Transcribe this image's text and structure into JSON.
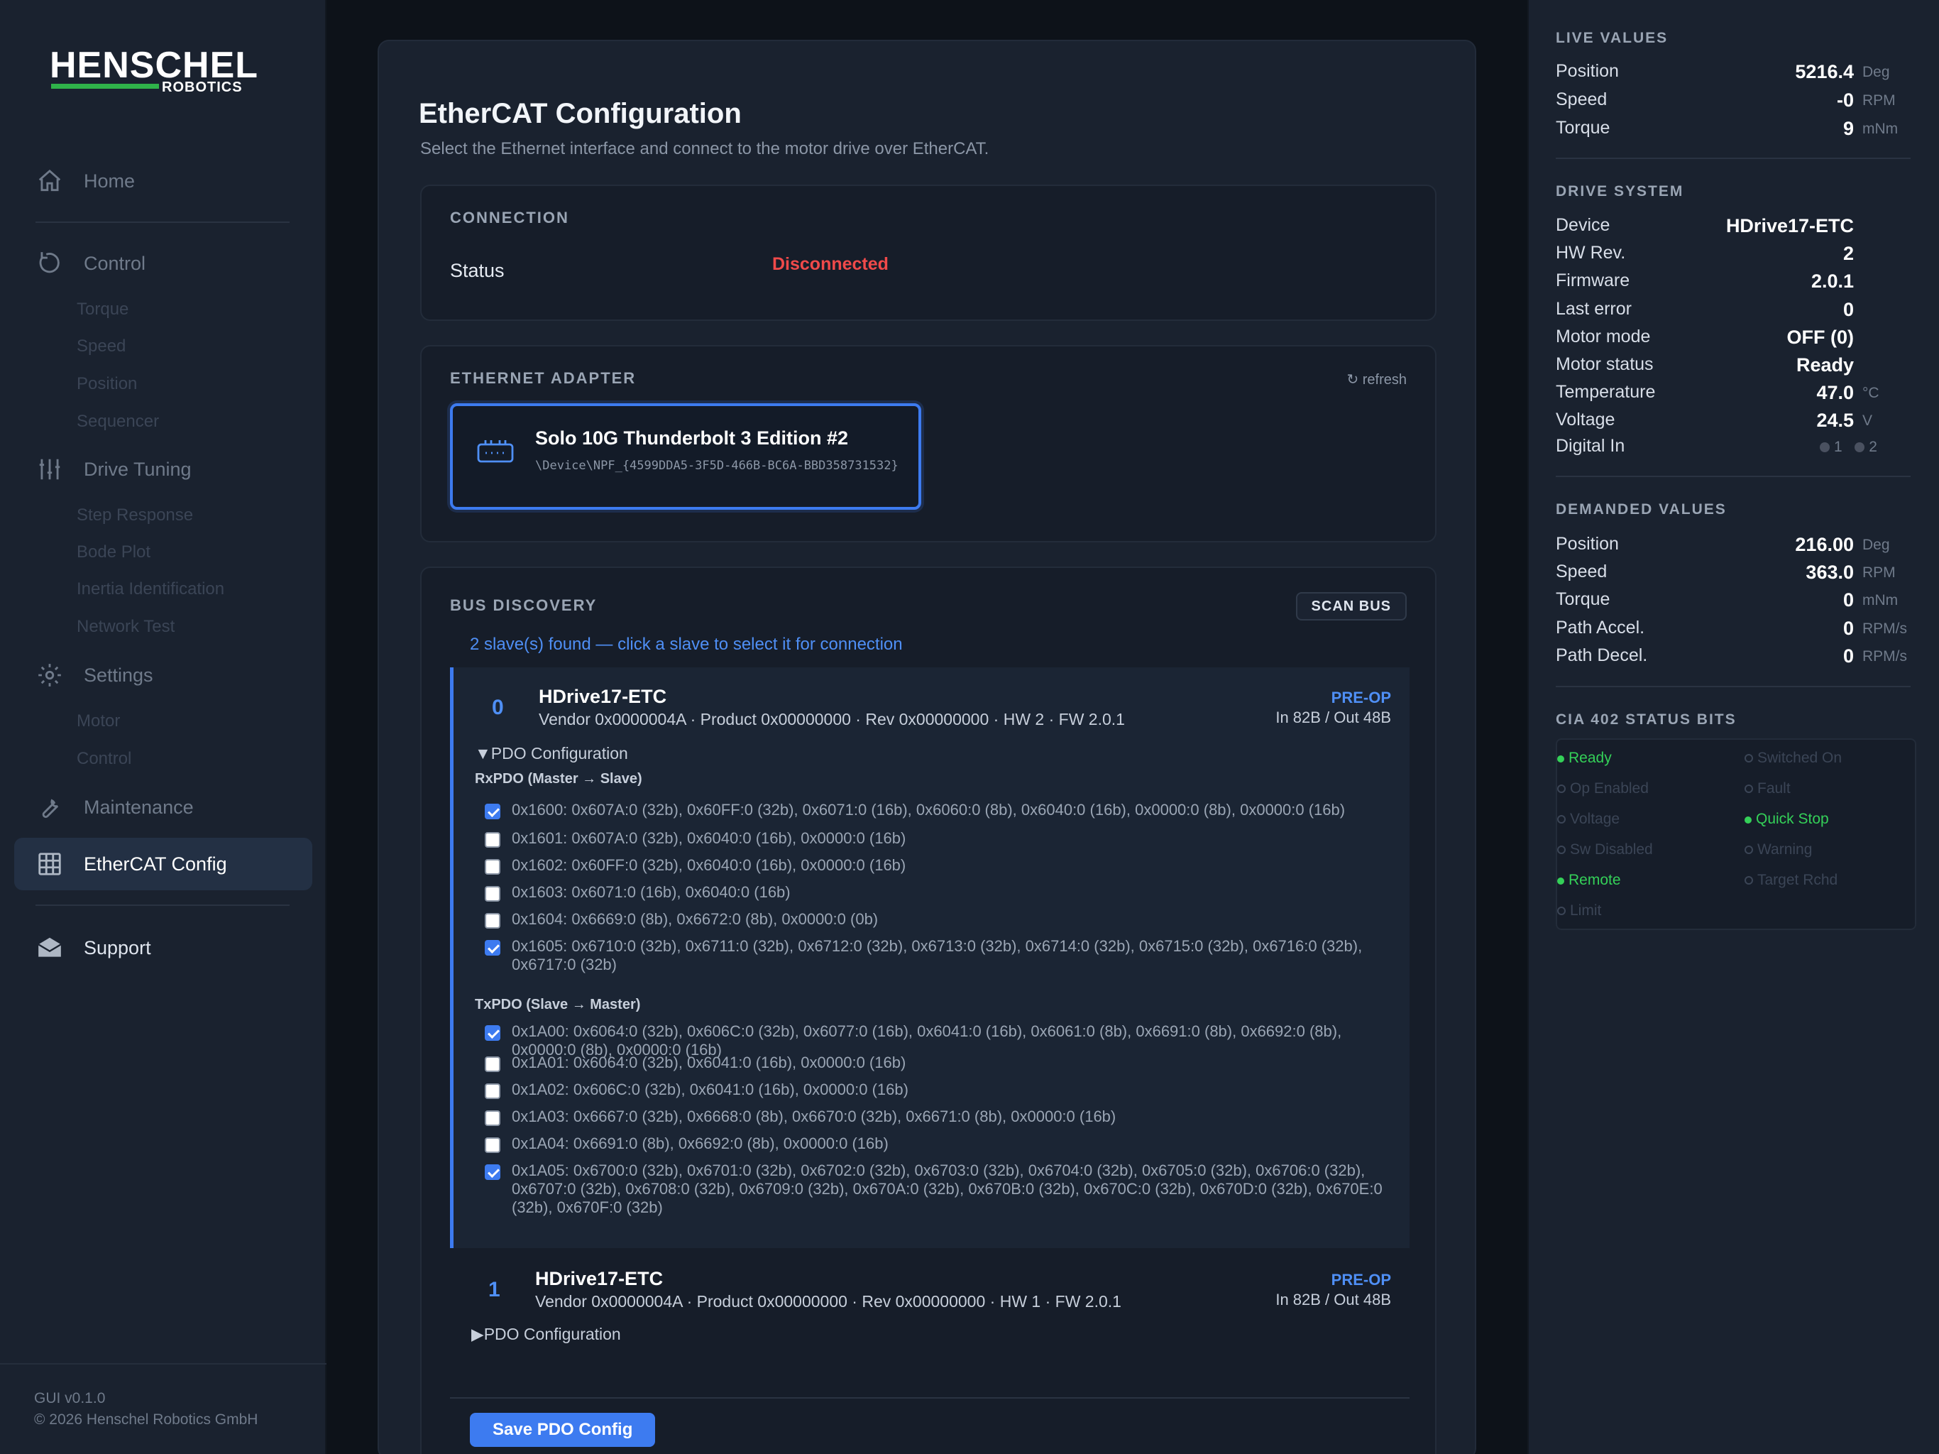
{
  "sidebar": {
    "brand": "HENSCHEL",
    "brand_sub": "ROBOTICS",
    "home": "Home",
    "control": "Control",
    "control_items": [
      "Torque",
      "Speed",
      "Position",
      "Sequencer"
    ],
    "drive_tuning": "Drive Tuning",
    "drive_tuning_items": [
      "Step Response",
      "Bode Plot",
      "Inertia Identification",
      "Network Test"
    ],
    "settings": "Settings",
    "settings_items": [
      "Motor",
      "Control"
    ],
    "maintenance": "Maintenance",
    "ethercat": "EtherCAT Config",
    "support": "Support",
    "version": "GUI v0.1.0",
    "copyright": "© 2026 Henschel Robotics GmbH"
  },
  "main": {
    "title": "EtherCAT Configuration",
    "subtitle": "Select the Ethernet interface and connect to the motor drive over EtherCAT.",
    "connection": {
      "header": "CONNECTION",
      "status_label": "Status",
      "status_value": "Disconnected"
    },
    "adapter": {
      "header": "ETHERNET ADAPTER",
      "refresh": "↻ refresh",
      "name": "Solo 10G Thunderbolt 3 Edition #2",
      "path": "\\Device\\NPF_{4599DDA5-3F5D-466B-BC6A-BBD358731532}"
    },
    "bus": {
      "header": "BUS DISCOVERY",
      "scan": "SCAN BUS",
      "found": "2 slave(s) found — click a slave to select it for connection",
      "slaves": [
        {
          "index": "0",
          "name": "HDrive17-ETC",
          "info": "Vendor 0x0000004A · Product 0x00000000 · Rev 0x00000000 · HW 2 · FW 2.0.1",
          "state": "PRE-OP",
          "io": "In 82B / Out 48B",
          "pdo_toggle": "▼PDO Configuration",
          "rx_header": "RxPDO (Master → Slave)",
          "tx_header": "TxPDO (Slave → Master)",
          "rx": [
            {
              "text": "0x1600: 0x607A:0 (32b), 0x60FF:0 (32b), 0x6071:0 (16b), 0x6060:0 (8b), 0x6040:0 (16b), 0x0000:0 (8b), 0x0000:0 (16b)",
              "checked": true
            },
            {
              "text": "0x1601: 0x607A:0 (32b), 0x6040:0 (16b), 0x0000:0 (16b)",
              "checked": false
            },
            {
              "text": "0x1602: 0x60FF:0 (32b), 0x6040:0 (16b), 0x0000:0 (16b)",
              "checked": false
            },
            {
              "text": "0x1603: 0x6071:0 (16b), 0x6040:0 (16b)",
              "checked": false
            },
            {
              "text": "0x1604: 0x6669:0 (8b), 0x6672:0 (8b), 0x0000:0 (0b)",
              "checked": false
            },
            {
              "text": "0x1605: 0x6710:0 (32b), 0x6711:0 (32b), 0x6712:0 (32b), 0x6713:0 (32b), 0x6714:0 (32b), 0x6715:0 (32b), 0x6716:0 (32b), 0x6717:0 (32b)",
              "checked": true
            }
          ],
          "tx": [
            {
              "text": "0x1A00: 0x6064:0 (32b), 0x606C:0 (32b), 0x6077:0 (16b), 0x6041:0 (16b), 0x6061:0 (8b), 0x6691:0 (8b), 0x6692:0 (8b), 0x0000:0 (8b), 0x0000:0 (16b)",
              "checked": true
            },
            {
              "text": "0x1A01: 0x6064:0 (32b), 0x6041:0 (16b), 0x0000:0 (16b)",
              "checked": false
            },
            {
              "text": "0x1A02: 0x606C:0 (32b), 0x6041:0 (16b), 0x0000:0 (16b)",
              "checked": false
            },
            {
              "text": "0x1A03: 0x6667:0 (32b), 0x6668:0 (8b), 0x6670:0 (32b), 0x6671:0 (8b), 0x0000:0 (16b)",
              "checked": false
            },
            {
              "text": "0x1A04: 0x6691:0 (8b), 0x6692:0 (8b), 0x0000:0 (16b)",
              "checked": false
            },
            {
              "text": "0x1A05: 0x6700:0 (32b), 0x6701:0 (32b), 0x6702:0 (32b), 0x6703:0 (32b), 0x6704:0 (32b), 0x6705:0 (32b), 0x6706:0 (32b), 0x6707:0 (32b), 0x6708:0 (32b), 0x6709:0 (32b), 0x670A:0 (32b), 0x670B:0 (32b), 0x670C:0 (32b), 0x670D:0 (32b), 0x670E:0 (32b), 0x670F:0 (32b)",
              "checked": true
            }
          ]
        },
        {
          "index": "1",
          "name": "HDrive17-ETC",
          "info": "Vendor 0x0000004A · Product 0x00000000 · Rev 0x00000000 · HW 1 · FW 2.0.1",
          "state": "PRE-OP",
          "io": "In 82B / Out 48B",
          "pdo_toggle": "▶PDO Configuration"
        }
      ],
      "save": "Save PDO Config"
    }
  },
  "right": {
    "live": {
      "header": "LIVE VALUES",
      "rows": [
        {
          "label": "Position",
          "value": "5216.4",
          "unit": "Deg"
        },
        {
          "label": "Speed",
          "value": "-0",
          "unit": "RPM"
        },
        {
          "label": "Torque",
          "value": "9",
          "unit": "mNm"
        }
      ]
    },
    "drive": {
      "header": "DRIVE SYSTEM",
      "rows": [
        {
          "label": "Device",
          "value": "HDrive17-ETC",
          "unit": ""
        },
        {
          "label": "HW Rev.",
          "value": "2",
          "unit": ""
        },
        {
          "label": "Firmware",
          "value": "2.0.1",
          "unit": ""
        },
        {
          "label": "Last error",
          "value": "0",
          "unit": ""
        },
        {
          "label": "Motor mode",
          "value": "OFF (0)",
          "unit": ""
        },
        {
          "label": "Motor status",
          "value": "Ready",
          "unit": ""
        },
        {
          "label": "Temperature",
          "value": "47.0",
          "unit": "°C"
        },
        {
          "label": "Voltage",
          "value": "24.5",
          "unit": "V"
        }
      ],
      "digital_label": "Digital In",
      "digital": [
        "1",
        "2"
      ]
    },
    "demanded": {
      "header": "DEMANDED VALUES",
      "rows": [
        {
          "label": "Position",
          "value": "216.00",
          "unit": "Deg"
        },
        {
          "label": "Speed",
          "value": "363.0",
          "unit": "RPM"
        },
        {
          "label": "Torque",
          "value": "0",
          "unit": "mNm"
        },
        {
          "label": "Path Accel.",
          "value": "0",
          "unit": "RPM/s"
        },
        {
          "label": "Path Decel.",
          "value": "0",
          "unit": "RPM/s"
        }
      ]
    },
    "cia": {
      "header": "CIA 402 STATUS BITS",
      "bits": [
        {
          "label": "Ready",
          "on": true
        },
        {
          "label": "Switched On",
          "on": false
        },
        {
          "label": "Op Enabled",
          "on": false
        },
        {
          "label": "Fault",
          "on": false
        },
        {
          "label": "Voltage",
          "on": false
        },
        {
          "label": "Quick Stop",
          "on": true
        },
        {
          "label": "Sw Disabled",
          "on": false
        },
        {
          "label": "Warning",
          "on": false
        },
        {
          "label": "Remote",
          "on": true
        },
        {
          "label": "Target Rchd",
          "on": false
        },
        {
          "label": "Limit",
          "on": false
        }
      ]
    }
  },
  "colors": {
    "accent": "#3d7bf0",
    "error": "#f04a4a",
    "ok": "#34d058",
    "brand_green": "#2fb34a"
  }
}
